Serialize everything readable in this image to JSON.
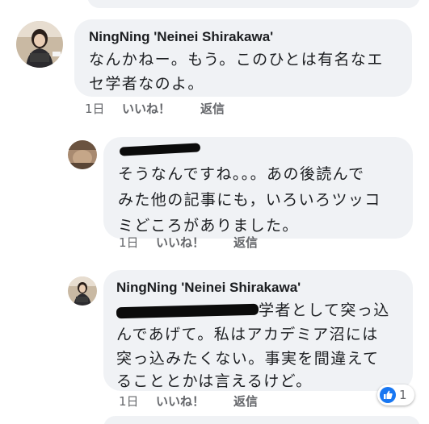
{
  "comments": [
    {
      "author": "NingNing 'Neinei Shirakawa'",
      "lines": [
        "なんかねー。もう。このひとは有名なエ",
        "セ学者なのよ。"
      ],
      "time": "1日",
      "like_label": "いいね！",
      "reply_label": "返信"
    },
    {
      "author": "",
      "lines": [
        "そうなんですね。。。あの後読んで",
        "みた他の記事にも，いろいろツッコ",
        "ミどころがありました。"
      ],
      "time": "1日",
      "like_label": "いいね！",
      "reply_label": "返信"
    },
    {
      "author": "NingNing 'Neinei Shirakawa'",
      "line1_tail": "学者として突っ込",
      "lines": [
        "んであげて。私はアカデミア沼には",
        "突っ込みたくない。事実を間違えて",
        "ることとかは言えるけど。"
      ],
      "time": "1日",
      "like_label": "いいね！",
      "reply_label": "返信",
      "reactions": {
        "icon": "thumbs-up-icon",
        "count": "1",
        "color": "#1877f2"
      }
    }
  ]
}
